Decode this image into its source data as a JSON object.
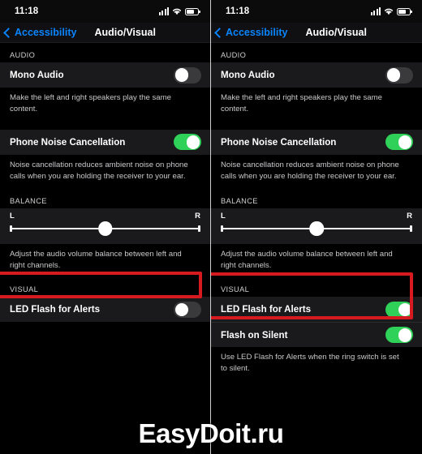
{
  "watermark": "EasyDoit.ru",
  "colors": {
    "accent_blue": "#0a84ff",
    "toggle_on_green": "#30d158",
    "toggle_off_gray": "#3a3a3c",
    "highlight_red": "#d71920",
    "row_background": "#1a1a1c",
    "page_background": "#000000"
  },
  "status_bar": {
    "time": "11:18",
    "signal_icon": "cellular-signal-icon",
    "wifi_icon": "wifi-icon",
    "battery_icon": "battery-icon"
  },
  "nav_bar": {
    "back_icon": "chevron-left-icon",
    "back_label": "Accessibility",
    "title": "Audio/Visual"
  },
  "panels": [
    {
      "id": "before",
      "groups": [
        {
          "header": "AUDIO",
          "rows": [
            {
              "label": "Mono Audio",
              "control": "toggle",
              "state": "off"
            }
          ],
          "footer": "Make the left and right speakers play the same content."
        },
        {
          "header": "",
          "rows": [
            {
              "label": "Phone Noise Cancellation",
              "control": "toggle",
              "state": "on"
            }
          ],
          "footer": "Noise cancellation reduces ambient noise on phone calls when you are holding the receiver to your ear."
        },
        {
          "header": "BALANCE",
          "slider": {
            "left_label": "L",
            "right_label": "R",
            "value": 50
          },
          "footer": "Adjust the audio volume balance between left and right channels."
        },
        {
          "header": "VISUAL",
          "rows": [
            {
              "label": "LED Flash for Alerts",
              "control": "toggle",
              "state": "off"
            }
          ],
          "footer": ""
        }
      ]
    },
    {
      "id": "after",
      "groups": [
        {
          "header": "AUDIO",
          "rows": [
            {
              "label": "Mono Audio",
              "control": "toggle",
              "state": "off"
            }
          ],
          "footer": "Make the left and right speakers play the same content."
        },
        {
          "header": "",
          "rows": [
            {
              "label": "Phone Noise Cancellation",
              "control": "toggle",
              "state": "on"
            }
          ],
          "footer": "Noise cancellation reduces ambient noise on phone calls when you are holding the receiver to your ear."
        },
        {
          "header": "BALANCE",
          "slider": {
            "left_label": "L",
            "right_label": "R",
            "value": 50
          },
          "footer": "Adjust the audio volume balance between left and right channels."
        },
        {
          "header": "VISUAL",
          "rows": [
            {
              "label": "LED Flash for Alerts",
              "control": "toggle",
              "state": "on"
            },
            {
              "label": "Flash on Silent",
              "control": "toggle",
              "state": "on"
            }
          ],
          "footer": "Use LED Flash for Alerts when the ring switch is set to silent."
        }
      ]
    }
  ]
}
